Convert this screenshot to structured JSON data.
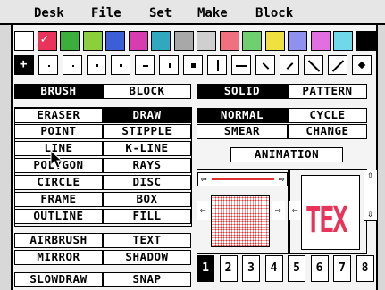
{
  "menu": [
    "Desk",
    "File",
    "Set",
    "Make",
    "Block"
  ],
  "palette": {
    "colors": [
      "#ffffff",
      "#e8345a",
      "#3cae3c",
      "#8ccf3c",
      "#3c5fd8",
      "#d83cae",
      "#30a8c0",
      "#a8a8a8",
      "#cfcfcf",
      "#f07080",
      "#70d070",
      "#f0e040",
      "#9090f0",
      "#e070e0",
      "#70d8e8",
      "#000000"
    ],
    "selected_index": 1,
    "check_glyph": "✓"
  },
  "brushes": [
    {
      "icon": "crosshair-brush"
    },
    {
      "icon": "dot-small-brush"
    },
    {
      "icon": "dot-small-brush"
    },
    {
      "icon": "dot-medium-brush"
    },
    {
      "icon": "dot-medium-brush"
    },
    {
      "icon": "dash-short-brush"
    },
    {
      "icon": "dash-vertical-brush"
    },
    {
      "icon": "square-brush"
    },
    {
      "icon": "bar-vertical-brush"
    },
    {
      "icon": "bar-horizontal-brush"
    },
    {
      "icon": "slash-back-short-brush"
    },
    {
      "icon": "slash-short-brush"
    },
    {
      "icon": "slash-back-long-brush"
    },
    {
      "icon": "slash-long-brush"
    },
    {
      "icon": "diamond-brush"
    }
  ],
  "mode": {
    "brush": "BRUSH",
    "block": "BLOCK"
  },
  "fill": {
    "solid": "SOLID",
    "pattern": "PATTERN"
  },
  "draw_modes": {
    "normal": "NORMAL",
    "cycle": "CYCLE",
    "smear": "SMEAR",
    "change": "CHANGE",
    "animation": "ANIMATION"
  },
  "tools": {
    "eraser": "ERASER",
    "draw": "DRAW",
    "point": "POINT",
    "stipple": "STIPPLE",
    "line": "LINE",
    "kline": "K-LINE",
    "polygon": "POLYGON",
    "rays": "RAYS",
    "circle": "CIRCLE",
    "disc": "DISC",
    "frame": "FRAME",
    "box": "BOX",
    "outline": "OUTLINE",
    "fill": "FILL"
  },
  "effects": {
    "airbrush": "AIRBRUSH",
    "text": "TEXT",
    "mirror": "MIRROR",
    "shadow": "SHADOW"
  },
  "options": {
    "slowdraw": "SLOWDRAW",
    "snap": "SNAP"
  },
  "arrows": {
    "left": "⇦",
    "right": "⇨",
    "up": "⇧",
    "down": "⇩"
  },
  "preview": {
    "text": "TEX",
    "text_color": "#e8345a",
    "pattern_color": "#e03030",
    "line_color": "#e03030"
  },
  "screens": [
    "1",
    "2",
    "3",
    "4",
    "5",
    "6",
    "7",
    "8"
  ],
  "screens_selected": 0
}
